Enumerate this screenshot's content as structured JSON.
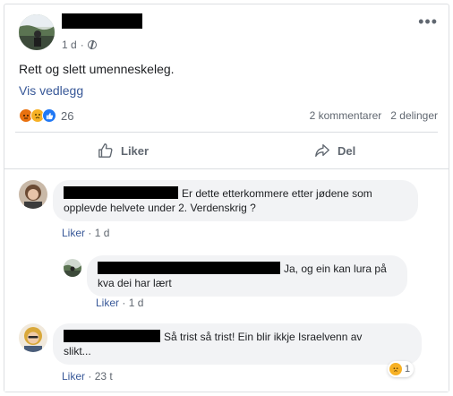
{
  "post": {
    "time": "1 d",
    "text": "Rett og slett umenneskeleg.",
    "attachment_link": "Vis vedlegg",
    "reaction_count": "26",
    "comments_count": "2 kommentarer",
    "shares_count": "2 delinger"
  },
  "actions": {
    "like": "Liker",
    "share": "Del"
  },
  "comments": [
    {
      "text_line1": "Er dette etterkommere etter jødene som",
      "text_line2": "opplevde helvete under 2. Verdenskrig ?",
      "like": "Liker",
      "time": "1 d"
    },
    {
      "text_line1": "Ja, og ein kan lura på",
      "text_line2": "kva dei har lært",
      "like": "Liker",
      "time": "1 d"
    },
    {
      "text_line1": "Så trist så trist! Ein blir ikkje Israelvenn av",
      "text_line2": "slikt...",
      "like": "Liker",
      "time": "23 t",
      "reaction_count": "1"
    }
  ],
  "icons": [
    "angry-reaction-icon",
    "sad-reaction-icon",
    "like-reaction-icon",
    "thumbs-up-icon",
    "share-icon",
    "globe-icon",
    "more-icon"
  ],
  "colors": {
    "link": "#385898",
    "like": "#2078f4",
    "angry": "#e9710f",
    "sad": "#f7b125"
  }
}
